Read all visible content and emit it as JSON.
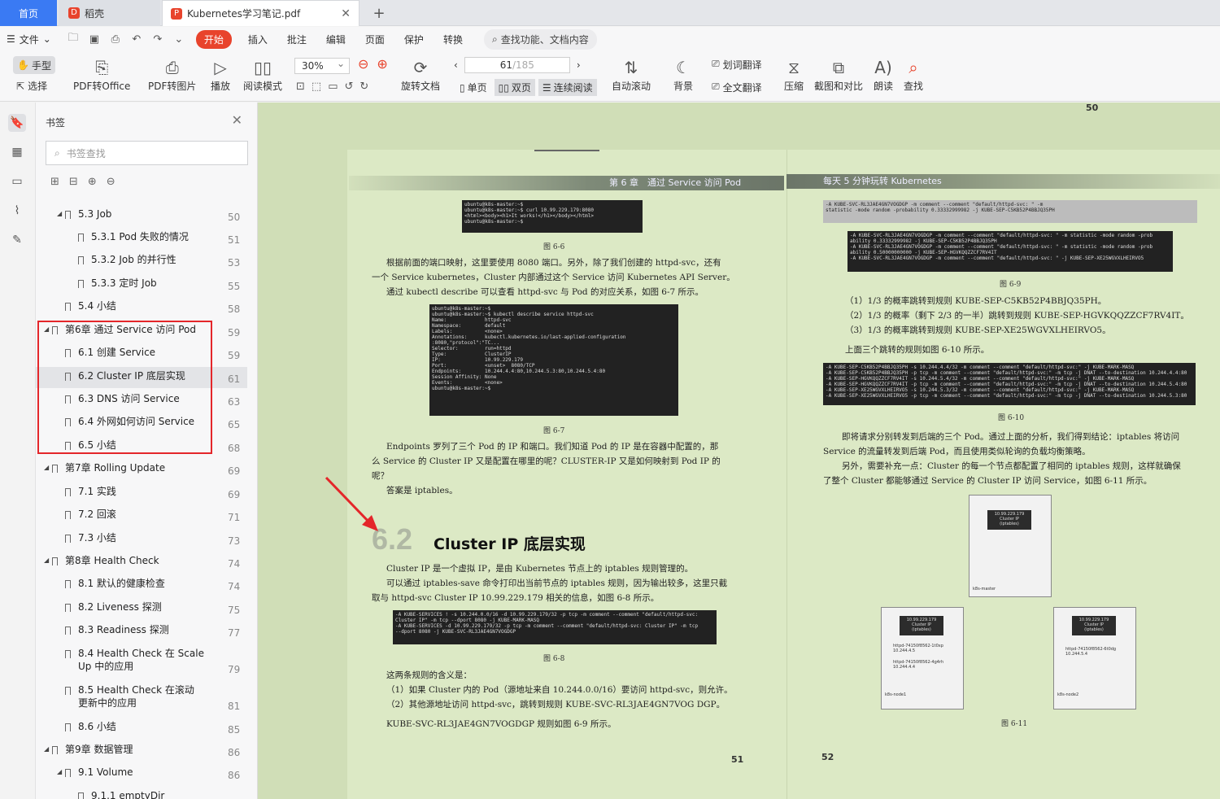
{
  "tabs": {
    "home": "首页",
    "docer": "稻壳",
    "pdf": "Kubernetes学习笔记.pdf",
    "add": "+"
  },
  "menu": {
    "file": "文件",
    "tabs": [
      "开始",
      "插入",
      "批注",
      "编辑",
      "页面",
      "保护",
      "转换"
    ],
    "search": "查找功能、文档内容"
  },
  "toolbar": {
    "hand": "手型",
    "select": "选择",
    "pdf_office": "PDF转Office",
    "pdf_image": "PDF转图片",
    "play": "播放",
    "read_mode": "阅读模式",
    "zoom": "30%",
    "rotate": "旋转文档",
    "page_current": "61",
    "page_total": "/185",
    "single": "单页",
    "double": "双页",
    "continuous": "连续阅读",
    "autoscroll": "自动滚动",
    "background": "背景",
    "translate_word": "划词翻译",
    "translate_full": "全文翻译",
    "compress": "压缩",
    "compare": "截图和对比",
    "read_aloud": "朗读",
    "find": "查找"
  },
  "sidebar": {
    "title": "书签",
    "search_placeholder": "书签查找",
    "items": [
      {
        "label": "5.3 Job",
        "page": "50",
        "level": 1,
        "expand": true
      },
      {
        "label": "5.3.1 Pod 失败的情况",
        "page": "51",
        "level": 2
      },
      {
        "label": "5.3.2 Job 的并行性",
        "page": "53",
        "level": 2
      },
      {
        "label": "5.3.3 定时 Job",
        "page": "55",
        "level": 2
      },
      {
        "label": "5.4 小结",
        "page": "58",
        "level": 1
      },
      {
        "label": "第6章 通过 Service 访问 Pod",
        "page": "59",
        "level": 0,
        "expand": true
      },
      {
        "label": "6.1 创建 Service",
        "page": "59",
        "level": 1
      },
      {
        "label": "6.2 Cluster IP 底层实现",
        "page": "61",
        "level": 1,
        "selected": true
      },
      {
        "label": "6.3 DNS 访问 Service",
        "page": "63",
        "level": 1
      },
      {
        "label": "6.4 外网如何访问 Service",
        "page": "65",
        "level": 1
      },
      {
        "label": "6.5 小结",
        "page": "68",
        "level": 1
      },
      {
        "label": "第7章 Rolling Update",
        "page": "69",
        "level": 0,
        "expand": true
      },
      {
        "label": "7.1 实践",
        "page": "69",
        "level": 1
      },
      {
        "label": "7.2 回滚",
        "page": "71",
        "level": 1
      },
      {
        "label": "7.3 小结",
        "page": "73",
        "level": 1
      },
      {
        "label": "第8章 Health Check",
        "page": "74",
        "level": 0,
        "expand": true
      },
      {
        "label": "8.1 默认的健康检查",
        "page": "74",
        "level": 1
      },
      {
        "label": "8.2 Liveness 探测",
        "page": "75",
        "level": 1
      },
      {
        "label": "8.3 Readiness 探测",
        "page": "77",
        "level": 1
      },
      {
        "label": "8.4 Health Check 在 Scale",
        "label2": "Up 中的应用",
        "page": "79",
        "level": 1
      },
      {
        "label": "8.5 Health Check 在滚动",
        "label2": "更新中的应用",
        "page": "81",
        "level": 1
      },
      {
        "label": "8.6 小结",
        "page": "85",
        "level": 1
      },
      {
        "label": "第9章 数据管理",
        "page": "86",
        "level": 0,
        "expand": true
      },
      {
        "label": "9.1 Volume",
        "page": "86",
        "level": 1,
        "expand": true
      },
      {
        "label": "9.1.1 emptyDir",
        "page": "",
        "level": 2
      }
    ]
  },
  "doc": {
    "top_page": "50",
    "header_left": "第 6 章　通过 Service 访问 Pod",
    "header_right": "每天 5 分钟玩转 Kubernetes",
    "code1": "ubuntu@k8s-master:~$\nubuntu@k8s-master:~$ curl 10.99.229.179:8080\n<html><body><h1>It works!</h1></body></html>\nubuntu@k8s-master:~$",
    "fig66": "图 6-6",
    "p1": "根据前面的端口映射，这里要使用 8080 端口。另外，除了我们创建的 httpd-svc，还有",
    "p2": "一个 Service kubernetes，Cluster 内部通过这个 Service 访问 Kubernetes API Server。",
    "p3": "通过 kubectl describe 可以查看 httpd-svc 与 Pod 的对应关系，如图 6-7 所示。",
    "code2": "ubuntu@k8s-master:~$\nubuntu@k8s-master:~$ kubectl describe service httpd-svc\nName:             httpd-svc\nNamespace:        default\nLabels:           <none>\nAnnotations:      kubectl.kubernetes.io/last-applied-configuration\n:8080,\"protocol\":\"TC...\nSelector:         run=httpd\nType:             ClusterIP\nIP:               10.99.229.179\nPort:             <unset>  8080/TCP\nEndpoints:        10.244.4.4:80,10.244.5.3:80,10.244.5.4:80\nSession Affinity: None\nEvents:           <none>\nubuntu@k8s-master:~$",
    "fig67": "图 6-7",
    "p4": "Endpoints 罗列了三个 Pod 的 IP 和端口。我们知道 Pod 的 IP 是在容器中配置的，那",
    "p5": "么 Service 的 Cluster IP 又是配置在哪里的呢？CLUSTER-IP 又是如何映射到 Pod IP 的",
    "p6": "呢？",
    "p7": "答案是 iptables。",
    "sec_num": "6.2",
    "sec_title": "Cluster IP  底层实现",
    "p8": "Cluster IP 是一个虚拟 IP，是由 Kubernetes 节点上的 iptables 规则管理的。",
    "p9": "可以通过 iptables-save 命令打印出当前节点的 iptables 规则，因为输出较多，这里只截",
    "p10": "取与 httpd-svc Cluster IP 10.99.229.179 相关的信息，如图 6-8 所示。",
    "code3": "-A KUBE-SERVICES ! -s 10.244.0.0/16 -d 10.99.229.179/32 -p tcp -m comment --comment \"default/httpd-svc:\nCluster IP\" -m tcp --dport 8080 -j KUBE-MARK-MASQ\n-A KUBE-SERVICES -d 10.99.229.179/32 -p tcp -m comment --comment \"default/httpd-svc: Cluster IP\" -m tcp\n--dport 8080 -j KUBE-SVC-RL3JAE4GN7VOGDGP",
    "fig68": "图 6-8",
    "p11": "这两条规则的含义是：",
    "p12": "（1）如果 Cluster 内的 Pod（源地址来自 10.244.0.0/16）要访问 httpd-svc，则允许。",
    "p13": "（2）其他源地址访问 httpd-svc，跳转到规则 KUBE-SVC-RL3JAE4GN7VOG DGP。",
    "p14": "KUBE-SVC-RL3JAE4GN7VOGDGP 规则如图 6-9 所示。",
    "page51": "51",
    "code4": "-A KUBE-SVC-RL3JAE4GN7VOGDGP -m comment --comment \"default/httpd-svc: \" -m\nstatistic -mode random -probability 0.33332999982 -j KUBE-SEP-C5KB52P4BBJQ35PH",
    "code5": "-A KUBE-SVC-RL3JAE4GN7VOGDGP -m comment --comment \"default/httpd-svc: \" -m statistic -mode random -prob\nability 0.33332999982 -j KUBE-SEP-C5KB52P4BBJQ35PH\n-A KUBE-SVC-RL3JAE4GN7VOGDGP -m comment --comment \"default/httpd-svc: \" -m statistic -mode random -prob\nability 0.50000000000 -j KUBE-SEP-HGVKQQZZCF7RV4IT\n-A KUBE-SVC-RL3JAE4GN7VOGDGP -m comment --comment \"default/httpd-svc: \" -j KUBE-SEP-XE25WGVXLHEIRVO5",
    "fig69": "图 6-9",
    "r1": "（1）1/3 的概率跳转到规则 KUBE-SEP-C5KB52P4BBJQ35PH。",
    "r2": "（2）1/3 的概率（剩下 2/3 的一半）跳转到规则 KUBE-SEP-HGVKQQZZCF7RV4IT。",
    "r3": "（3）1/3 的概率跳转到规则 KUBE-SEP-XE25WGVXLHEIRVO5。",
    "r4": "上面三个跳转的规则如图 6-10 所示。",
    "code6": "-A KUBE-SEP-C5KB52P4BBJQ35PH -s 10.244.4.4/32 -m comment --comment \"default/httpd-svc:\" -j KUBE-MARK-MASQ\n-A KUBE-SEP-C5KB52P4BBJQ35PH -p tcp -m comment --comment \"default/httpd-svc:\" -m tcp -j DNAT --to-destination 10.244.4.4:80\n-A KUBE-SEP-HGVKQQZZCF7RV4IT -s 10.244.5.4/32 -m comment --comment \"default/httpd-svc:\" -j KUBE-MARK-MASQ\n-A KUBE-SEP-HGVKQQZZCF7RV4IT -p tcp -m comment --comment \"default/httpd-svc:\" -m tcp -j DNAT --to-destination 10.244.5.4:80\n-A KUBE-SEP-XE25WGVXLHEIRVO5 -s 10.244.5.3/32 -m comment --comment \"default/httpd-svc:\" -j KUBE-MARK-MASQ\n-A KUBE-SEP-XE25WGVXLHEIRVO5 -p tcp -m comment --comment \"default/httpd-svc:\" -m tcp -j DNAT --to-destination 10.244.5.3:80",
    "fig610": "图 6-10",
    "r5": "即将请求分别转发到后端的三个 Pod。通过上面的分析，我们得到结论：iptables 将访问",
    "r6": "Service 的流量转发到后端 Pod，而且使用类似轮询的负载均衡策略。",
    "r7": "另外，需要补充一点：Cluster 的每一个节点都配置了相同的 iptables 规则，这样就确保",
    "r8": "了整个 Cluster 都能够通过 Service 的 Cluster IP 访问 Service，如图 6-11 所示。",
    "fig611": "图 6-11",
    "page52": "52",
    "node_ip": "10.99.229.179\nCluster IP\n(iptables)",
    "pod1": "httpd-74150f8562-1t0xp\n10.244.4.5",
    "pod2": "httpd-74150f8562-4g4rh\n10.244.4.4",
    "pod3": "httpd-74150f8562-6t0dg\n10.244.5.4",
    "master_lbl": "k8s-master",
    "node1_lbl": "k8s-node1",
    "node2_lbl": "k8s-node2"
  },
  "colors": {
    "accent": "#e8432c",
    "page_bg": "#d0deb7",
    "highlight": "#e4262a"
  }
}
